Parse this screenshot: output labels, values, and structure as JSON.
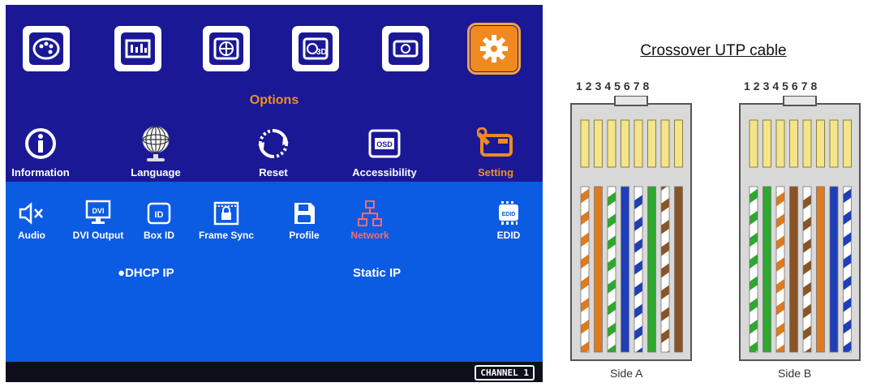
{
  "osd": {
    "top_icons": [
      {
        "name": "palette-icon"
      },
      {
        "name": "picture-settings-icon"
      },
      {
        "name": "globe-grid-icon"
      },
      {
        "name": "3d-icon"
      },
      {
        "name": "projector-icon"
      },
      {
        "name": "gear-icon",
        "selected": true
      }
    ],
    "options_label": "Options",
    "row2": [
      {
        "label": "Information",
        "icon": "info-icon"
      },
      {
        "label": "Language",
        "icon": "globe-icon"
      },
      {
        "label": "Reset",
        "icon": "reset-icon"
      },
      {
        "label": "Accessibility",
        "icon": "osd-icon"
      },
      {
        "label": "Setting",
        "icon": "wrench-icon",
        "selected": true
      }
    ],
    "submenu": [
      {
        "label": "Audio",
        "icon": "mute-icon"
      },
      {
        "label": "DVI Output",
        "icon": "dvi-icon"
      },
      {
        "label": "Box ID",
        "icon": "id-icon"
      },
      {
        "label": "Frame Sync",
        "icon": "lock-frame-icon"
      },
      {
        "label": "Profile",
        "icon": "save-icon"
      },
      {
        "label": "Network",
        "icon": "network-icon",
        "selected": true
      },
      {
        "label": "EDID",
        "icon": "edid-icon"
      }
    ],
    "network_options": {
      "dhcp": "DHCP IP",
      "static": "Static IP",
      "selected": "dhcp"
    },
    "channel": "CHANNEL 1",
    "colors": {
      "background": "#1b1896",
      "submenu": "#0b5be3",
      "accent": "#f08a20",
      "selected_sub": "#ff6a6a"
    }
  },
  "cable": {
    "title": "Crossover UTP cable",
    "pin_numbers": "12345678",
    "side_a": "Side A",
    "side_b": "Side B",
    "side_a_wires": [
      "white-orange",
      "orange",
      "white-green",
      "blue",
      "white-blue",
      "green",
      "white-brown",
      "brown"
    ],
    "side_b_wires": [
      "white-green",
      "green",
      "white-orange",
      "brown",
      "white-brown",
      "orange",
      "blue",
      "white-blue"
    ]
  }
}
